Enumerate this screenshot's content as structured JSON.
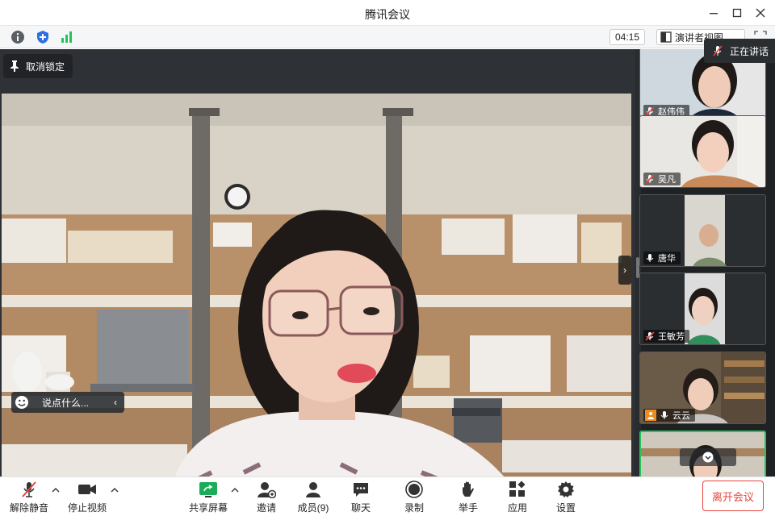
{
  "window": {
    "title": "腾讯会议"
  },
  "status": {
    "timer": "04:15",
    "view_label": "演讲者视图"
  },
  "stage": {
    "unpin_label": "取消锁定",
    "chat_placeholder": "说点什么..."
  },
  "speaking_label": "正在讲话",
  "participants": [
    {
      "name": "赵伟伟",
      "mic": "muted"
    },
    {
      "name": "吴凡",
      "mic": "muted"
    },
    {
      "name": "唐华",
      "mic": "on"
    },
    {
      "name": "王敏芳",
      "mic": "muted"
    },
    {
      "name": "云云",
      "mic": "on"
    },
    {
      "name": "",
      "mic": "on"
    }
  ],
  "toolbar": {
    "unmute": "解除静音",
    "stop_video": "停止视频",
    "share_screen": "共享屏幕",
    "invite": "邀请",
    "members": "成员(9)",
    "chat": "聊天",
    "record": "录制",
    "raise_hand": "举手",
    "apps": "应用",
    "settings": "设置",
    "leave": "离开会议"
  },
  "colors": {
    "accent_green": "#25c35b",
    "leave_red": "#e6453c",
    "mute_red": "#e6453c",
    "share_green": "#1aad58"
  }
}
